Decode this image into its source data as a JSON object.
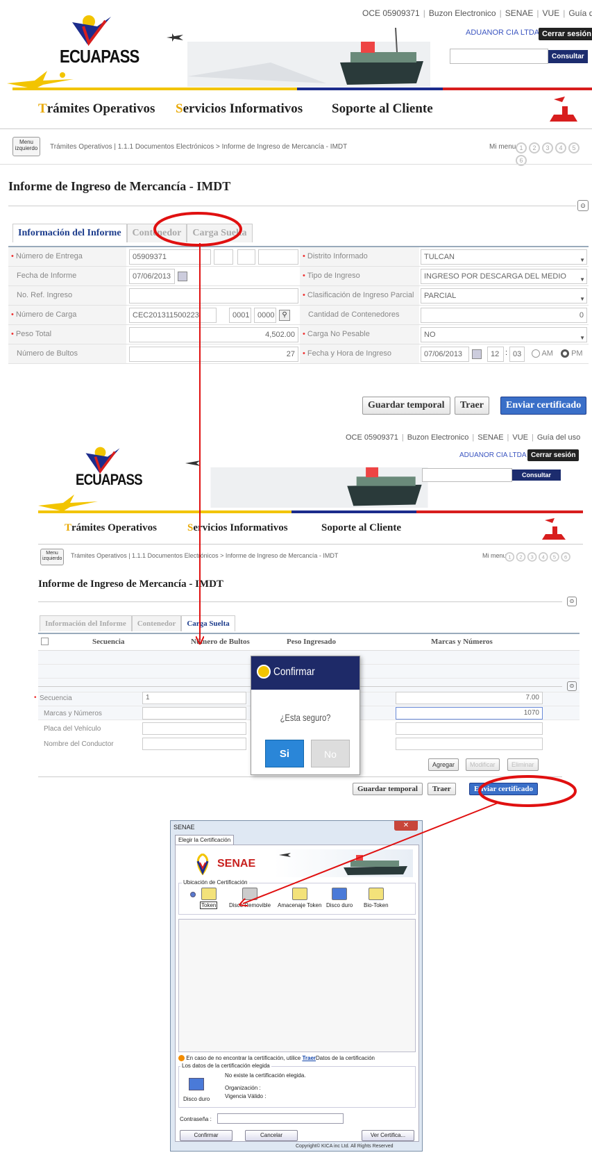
{
  "header": {
    "logo": "ECUAPASS",
    "top_links": [
      "OCE 05909371",
      "Buzon Electronico",
      "SENAE",
      "VUE",
      "Guía del uso"
    ],
    "company": "ADUANOR CIA LTDA",
    "logout": "Cerrar sesión",
    "consult": "Consultar"
  },
  "nav": {
    "tramites_initial": "T",
    "tramites_rest": "rámites Operativos",
    "servicios_initial": "S",
    "servicios_rest": "ervicios Informativos",
    "soporte": "Soporte al Cliente"
  },
  "breadcrumb": {
    "menu_line1": "Menu",
    "menu_line2": "izquierdo",
    "path": "Trámites Operativos  |  1.1.1 Documentos Electrónicos > Informe de Ingreso de Mercancía - IMDT",
    "mi_menu": "Mi menu",
    "circles": [
      "1",
      "2",
      "3",
      "4",
      "5",
      "6"
    ]
  },
  "page_title": "Informe de Ingreso de Mercancía - IMDT",
  "tabs": [
    "Información del Informe",
    "Contenedor",
    "Carga Suelta"
  ],
  "form": {
    "numero_entrega_label": "Número de Entrega",
    "numero_entrega": "05909371",
    "distrito_label": "Distrito Informado",
    "distrito": "TULCAN",
    "fecha_informe_label": "Fecha de Informe",
    "fecha_informe": "07/06/2013",
    "tipo_ingreso_label": "Tipo de Ingreso",
    "tipo_ingreso": "INGRESO POR DESCARGA DEL MEDIO",
    "ref_ingreso_label": "No. Ref. Ingreso",
    "ref_ingreso": "",
    "clasif_label": "Clasificación de Ingreso Parcial",
    "clasif": "PARCIAL",
    "numero_carga_label": "Número de Carga",
    "numero_carga": "CEC201311500223",
    "carga_a": "0001",
    "carga_b": "0000",
    "cant_cont_label": "Cantidad de Contenedores",
    "cant_cont": "0",
    "peso_label": "Peso Total",
    "peso": "4,502.00",
    "no_pesable_label": "Carga No Pesable",
    "no_pesable": "NO",
    "bultos_label": "Número de Bultos",
    "bultos": "27",
    "fecha_hora_label": "Fecha y Hora de Ingreso",
    "fecha_ingreso": "07/06/2013",
    "hora": "12",
    "minuto": "03",
    "am": "AM",
    "pm": "PM"
  },
  "actions": {
    "guardar": "Guardar temporal",
    "traer": "Traer",
    "enviar": "Enviar certificado"
  },
  "grid": {
    "columns": [
      "Secuencia",
      "Número de Bultos",
      "Peso Ingresado",
      "Marcas y Números"
    ]
  },
  "detail": {
    "secuencia_label": "Secuencia",
    "secuencia": "1",
    "marcas_label": "Marcas y Números",
    "placa_label": "Placa del Vehículo",
    "conductor_label": "Nombre del Conductor",
    "right_val1": "7.00",
    "right_val2": "1070",
    "agregar": "Agregar",
    "modificar": "Modificar",
    "eliminar": "Eliminar"
  },
  "confirm": {
    "title": "Confirmar",
    "question": "¿Esta seguro?",
    "yes": "Si",
    "no": "No"
  },
  "cert": {
    "title": "SENAE",
    "tab": "Elegir la Certificación",
    "brand": "SENAE",
    "location_label": "Ubicación de Certificación",
    "options": [
      "Token",
      "Disco Removible",
      "Amacenaje Token",
      "Disco duro",
      "Bio-Token"
    ],
    "hint_pre": "En caso de no encontrar la certificación, utilice",
    "hint_link": "Traer",
    "hint_post": "Datos de la certificación",
    "data_label": "Los datos de la certificación elegida",
    "no_cert": "No existe la certificación elegida.",
    "org": "Organización :",
    "vigencia": "Vigencia Válido :",
    "disk": "Disco duro",
    "password": "Contraseña :",
    "confirmar": "Confirmar",
    "cancelar": "Cancelar",
    "ver": "Ver Certifica...",
    "copyright": "Copyright© KICA inc Ltd. All Rights Reserved"
  },
  "colors": {
    "annotation": "#e01010",
    "nav_yellow": "#f2c400",
    "nav_blue": "#1c2c8c",
    "nav_red": "#d81e1e",
    "button_blue": "#3a6fc8"
  }
}
